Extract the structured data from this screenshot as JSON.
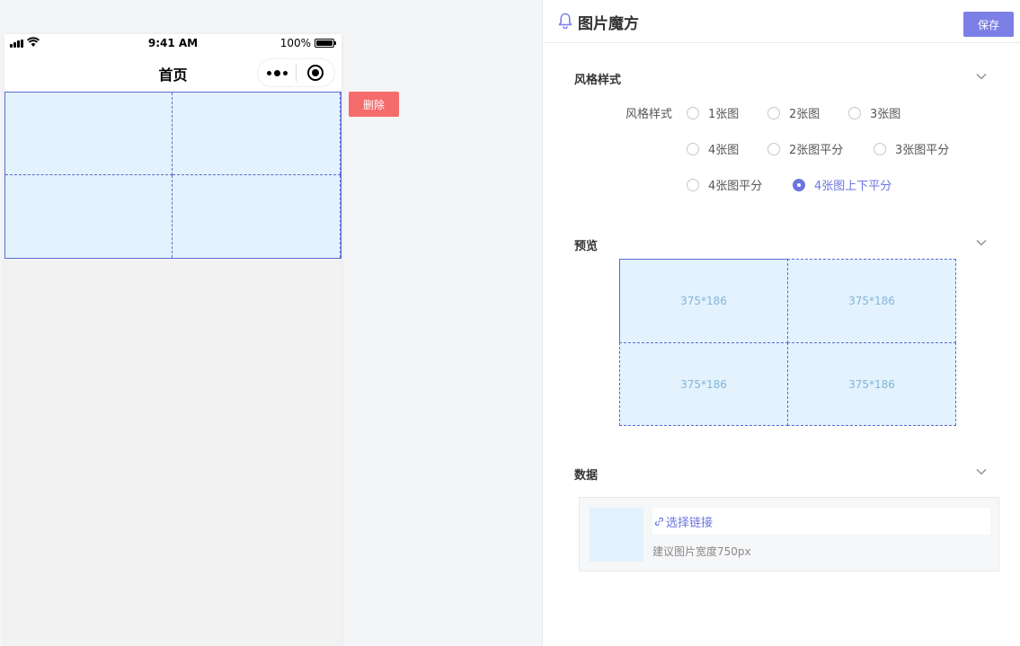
{
  "phone": {
    "status": {
      "time": "9:41 AM",
      "battery": "100%"
    },
    "nav": {
      "title": "首页"
    }
  },
  "canvas": {
    "delete_label": "删除"
  },
  "panel": {
    "title": "图片魔方",
    "save_label": "保存",
    "style_section": {
      "title": "风格样式",
      "label": "风格样式",
      "options": [
        "1张图",
        "2张图",
        "3张图",
        "4张图",
        "2张图平分",
        "3张图平分",
        "4张图平分",
        "4张图上下平分"
      ],
      "selected": "4张图上下平分"
    },
    "preview_section": {
      "title": "预览",
      "cells": [
        "375*186",
        "375*186",
        "375*186",
        "375*186"
      ]
    },
    "data_section": {
      "title": "数据",
      "link_label": "选择链接",
      "hint": "建议图片宽度750px"
    }
  },
  "colors": {
    "accent": "#6b75e0",
    "save_button": "#7b7fe6",
    "delete_button": "#f56c6c",
    "cube_fill": "#e3f2fd",
    "cube_border": "#5a6bd4"
  }
}
